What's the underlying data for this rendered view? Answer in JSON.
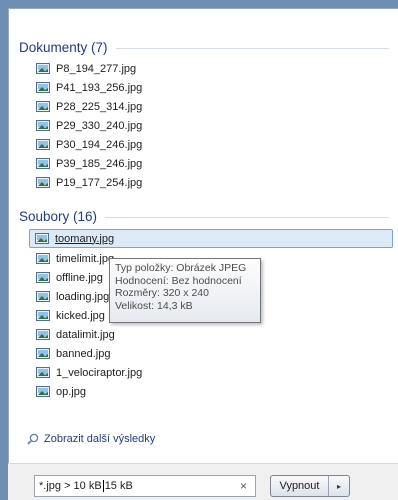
{
  "groups": [
    {
      "title": "Dokumenty (7)",
      "items": [
        "P8_194_277.jpg",
        "P41_193_256.jpg",
        "P28_225_314.jpg",
        "P29_330_240.jpg",
        "P30_194_246.jpg",
        "P39_185_246.jpg",
        "P19_177_254.jpg"
      ]
    },
    {
      "title": "Soubory (16)",
      "items": [
        "toomany.jpg",
        "timelimit.jpg",
        "offline.jpg",
        "loading.jpg",
        "kicked.jpg",
        "datalimit.jpg",
        "banned.jpg",
        "1_velociraptor.jpg",
        "op.jpg"
      ]
    }
  ],
  "tooltip": {
    "type": "Typ položky: Obrázek JPEG",
    "rating": "Hodnocení: Bez hodnocení",
    "dimensions": "Rozměry: 320 x 240",
    "size": "Velikost: 14,3 kB"
  },
  "more_results": "Zobrazit další výsledky",
  "search": {
    "value_before_caret": "*.jpg > 10 kB ",
    "value_after_caret": " 15 kB",
    "clear": "×"
  },
  "shutdown": {
    "label": "Vypnout",
    "arrow": "▸"
  }
}
